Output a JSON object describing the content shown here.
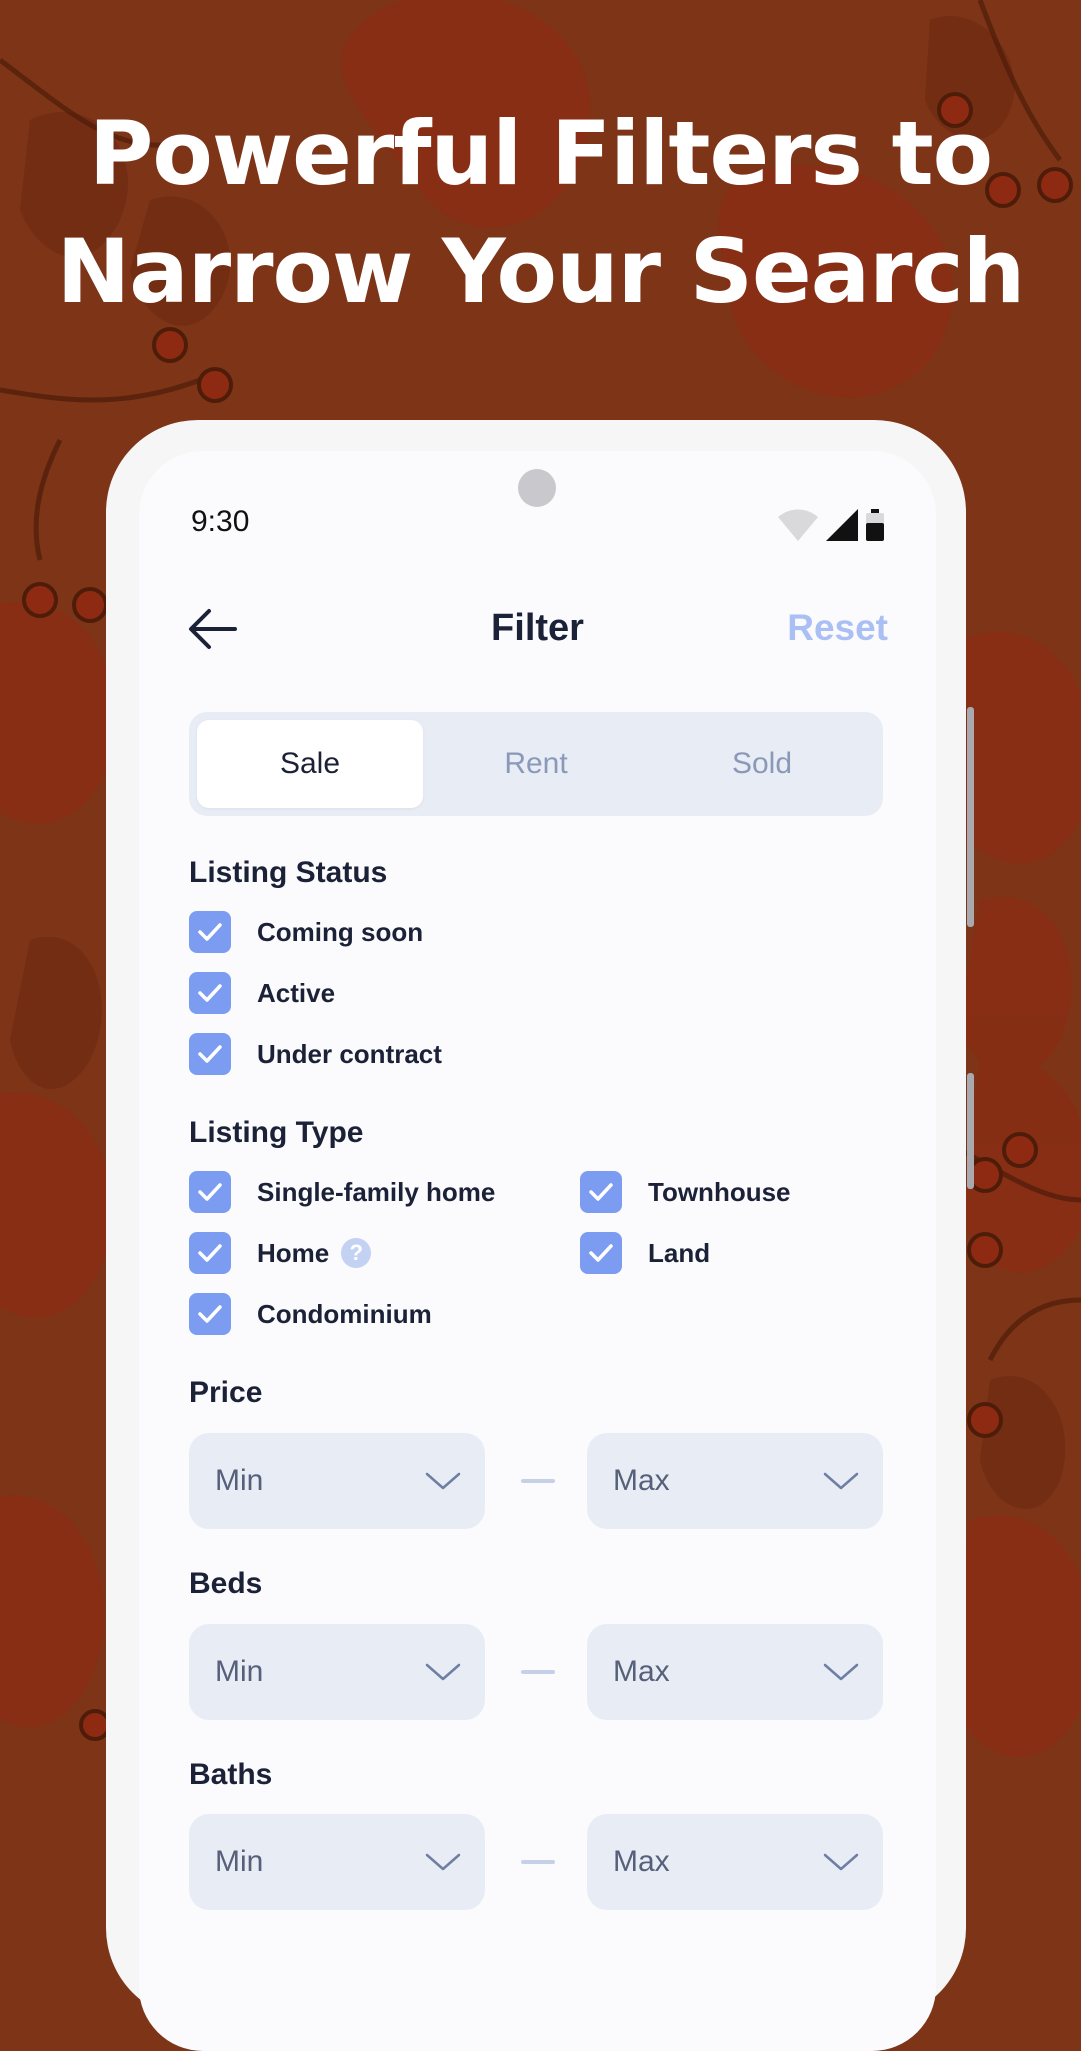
{
  "headline": {
    "line1": "Powerful Filters to",
    "line2": "Narrow Your Search"
  },
  "status_bar": {
    "time": "9:30"
  },
  "header": {
    "title": "Filter",
    "reset_label": "Reset"
  },
  "tabs": [
    {
      "label": "Sale",
      "active": true
    },
    {
      "label": "Rent",
      "active": false
    },
    {
      "label": "Sold",
      "active": false
    }
  ],
  "listing_status": {
    "title": "Listing Status",
    "options": [
      {
        "label": "Coming soon",
        "checked": true
      },
      {
        "label": "Active",
        "checked": true
      },
      {
        "label": "Under contract",
        "checked": true
      }
    ]
  },
  "listing_type": {
    "title": "Listing Type",
    "options": [
      {
        "label": "Single-family home",
        "checked": true
      },
      {
        "label": "Townhouse",
        "checked": true
      },
      {
        "label": "Home",
        "checked": true,
        "help_icon": "question-icon"
      },
      {
        "label": "Land",
        "checked": true
      },
      {
        "label": "Condominium",
        "checked": true
      }
    ],
    "help_glyph": "?"
  },
  "price": {
    "title": "Price",
    "min_placeholder": "Min",
    "max_placeholder": "Max"
  },
  "beds": {
    "title": "Beds",
    "min_placeholder": "Min",
    "max_placeholder": "Max"
  },
  "baths": {
    "title": "Baths",
    "min_placeholder": "Min",
    "max_placeholder": "Max"
  },
  "colors": {
    "background": "#7d3417",
    "accent": "#7b9cf0",
    "reset": "#aac0f4",
    "field_bg": "#e8ecf5"
  }
}
